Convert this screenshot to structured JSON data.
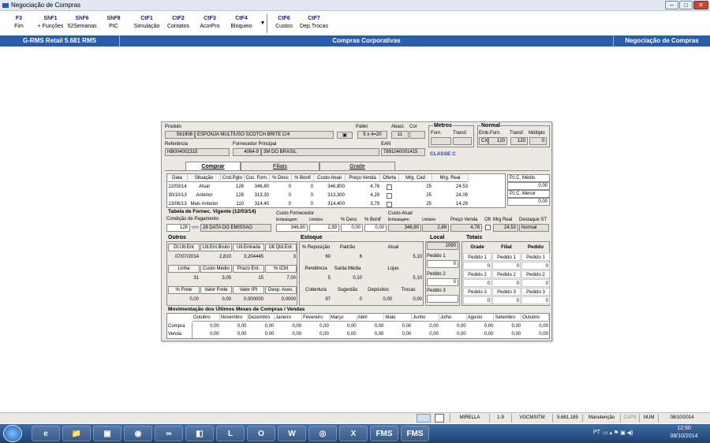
{
  "window": {
    "title": "Negociação de Compras",
    "controls": [
      "–",
      "□",
      "✕"
    ]
  },
  "fkeys": [
    {
      "key": "F3",
      "label": "Fim"
    },
    {
      "key": "ShF1",
      "label": "+ Funções"
    },
    {
      "key": "ShF6",
      "label": "52Semanas"
    },
    {
      "key": "ShF9",
      "label": "PIC"
    },
    {
      "key": "CtF1",
      "label": "Simulação"
    },
    {
      "key": "CtF2",
      "label": "Contatos"
    },
    {
      "key": "CtF3",
      "label": "AcorPro"
    },
    {
      "key": "CtF4",
      "label": "Bloqueio"
    },
    {
      "key": "CtF6",
      "label": "Custos"
    },
    {
      "key": "CtF7",
      "label": "Dep.Trocas"
    }
  ],
  "bluebar": {
    "left": "G-RMS Retail 5.681 RMS",
    "center": "Compras Corporativas",
    "right": "Negociação de Compras"
  },
  "product": {
    "produto_label": "Produto",
    "produto_code": "561908",
    "produto_desc": "ESPONJA MULTIUSO SCOTCH BRITE C/4",
    "pallet_label": "Pallet",
    "pallet_value": "5 x 4=20",
    "abast_label": "Abast.",
    "abast_value": "11",
    "cor_label": "Cor",
    "metros_label": "Metros",
    "forn_label": "Forn.",
    "transf_label": "Transf.",
    "normal_label": "Normal",
    "emb_forn_label": "Emb.Forn.",
    "transf2_label": "Transf.",
    "multiplo_label": "Múltiplo",
    "emb_unit": "CX",
    "emb_qty": "120",
    "transf_qty": "120",
    "multiplo_qty": "0",
    "referencia_label": "Referência",
    "referencia_value": "HB004002315",
    "fornecedor_label": "Fornecedor Principal",
    "fornecedor_code": "4064-9",
    "fornecedor_name": "3M DO BRASIL",
    "ean_label": "EAN",
    "ean_value": "7891040001415",
    "classe": "CLASSE C"
  },
  "tabs": [
    {
      "label": "Comprar"
    },
    {
      "label": "Filiais"
    },
    {
      "label": "Grade"
    }
  ],
  "history": {
    "headers": [
      "Data",
      "Situação",
      "Cnd.Pgto",
      "Cus. Forn.",
      "% Desc",
      "% Bonif",
      "Custo Atual",
      "Preço Venda",
      "Oferta",
      "Mrg. Cad",
      "Mrg. Real"
    ],
    "rows": [
      [
        "12/03/14",
        "Atual",
        "128",
        "346,80",
        "0",
        "0",
        "346,800",
        "4,78",
        "",
        "25",
        "24,53"
      ],
      [
        "30/10/13",
        "Anterior",
        "128",
        "313,30",
        "0",
        "0",
        "313,300",
        "4,29",
        "",
        "25",
        "24,09"
      ],
      [
        "13/06/13",
        "Mais Anterior",
        "110",
        "314,40",
        "0",
        "0",
        "314,400",
        "3,79",
        "",
        "25",
        "14,29"
      ]
    ],
    "pic_medio_label": "P.I.C. Médio",
    "pic_medio": "0.00",
    "pic_menor_label": "P.I.C. Menor",
    "pic_menor": "0.00"
  },
  "tabela": {
    "title": "Tabela de Fornec. Vigente (12/03/14)",
    "cond_label": "Condição de Pagamento",
    "cond_code": "128",
    "cond_desc": "28 DATA DO EMISSAO",
    "custo_forn_label": "Custo Fornecedor",
    "embalagem_label": "Embalagem",
    "unitario_label": "Unitário",
    "emb_value": "346,80",
    "unit_value": "2,89",
    "desc_label": "% Desc",
    "desc_value": "0,00",
    "bonif_label": "% Bonif",
    "bonif_value": "0,00",
    "custo_atual_label": "Custo Atual",
    "ca_emb_label": "Embalagem",
    "ca_unit_label": "Unitário",
    "ca_emb": "346,80",
    "ca_unit": "2,89",
    "preco_label": "Preço Venda",
    "preco_value": "4,78",
    "oft_label": "Oft",
    "mrg_label": "Mrg Real",
    "mrg_value": "24,53",
    "destaque_label": "Destaque ST",
    "destaque_value": "Normal"
  },
  "outros": {
    "title": "Outros",
    "row1_labels": [
      "Dt.Últ.Ent",
      "Últ.Ent.Bruto",
      "Últ.Entrada",
      "Últ.Qtd.Ent."
    ],
    "row1_values": [
      "07/07/2014",
      "2,810",
      "3,204445",
      "3"
    ],
    "row2_labels": [
      "Linha",
      "Custo Médio",
      "Prazo Ent.",
      "% ICM"
    ],
    "row2_values": [
      "31",
      "3,05",
      "15",
      "7,00"
    ],
    "row3_labels": [
      "% Frete",
      "Valor Frete",
      "Valor IPI",
      "Desp. Aces."
    ],
    "row3_values": [
      "0,00",
      "0,00",
      "0,000000",
      "0,0000"
    ]
  },
  "estoque": {
    "title": "Estoque",
    "row1_labels": [
      "% Reposição",
      "Padrão",
      "Atual"
    ],
    "row1_values": [
      "60",
      "6",
      "5,10"
    ],
    "row2_labels": [
      "Pendência",
      "Saída Média",
      "Lojas"
    ],
    "row2_values": [
      "5",
      "0,10",
      "5,10"
    ],
    "row3_labels": [
      "Cobertura",
      "Sugestão",
      "Depósitos",
      "Trocas"
    ],
    "row3_values": [
      "97",
      "0",
      "0,00",
      "0,00"
    ]
  },
  "local": {
    "title": "Local",
    "value": "1090",
    "pedido1_label": "Pedido 1",
    "pedido1": "0",
    "pedido2_label": "Pedido 2",
    "pedido2": "0",
    "pedido3_label": "Pedido 3",
    "pedido3": ""
  },
  "totais": {
    "title": "Totais",
    "headers": [
      "Grade",
      "Filial",
      "Pedido"
    ],
    "rows": [
      [
        "Pedido 1",
        "Pedido 1",
        "Pedido 1"
      ],
      [
        "0",
        "0",
        "0"
      ],
      [
        "Pedido 2",
        "Pedido 2",
        "Pedido 2"
      ],
      [
        "0",
        "0",
        "0"
      ],
      [
        "Pedido 3",
        "Pedido 3",
        "Pedido 3"
      ],
      [
        "0",
        "0",
        "0"
      ]
    ]
  },
  "movimentacao": {
    "title": "Movimentação dos Últimos Meses de Compras / Vendas",
    "months": [
      "Outubro",
      "Novembro",
      "Dezembro",
      "Janeiro",
      "Fevereiro",
      "Março",
      "Abril",
      "Maio",
      "Junho",
      "Julho",
      "Agosto",
      "Setembro",
      "Outubro"
    ],
    "rows": [
      {
        "label": "Compra",
        "values": [
          "0,00",
          "0,00",
          "0,00",
          "0,00",
          "0,00",
          "0,00",
          "0,00",
          "0,00",
          "0,00",
          "0,00",
          "0,00",
          "0,00",
          "0,00"
        ]
      },
      {
        "label": "Venda",
        "values": [
          "0,00",
          "0,00",
          "0,00",
          "0,00",
          "0,00",
          "0,00",
          "0,00",
          "0,00",
          "0,00",
          "0,00",
          "0,00",
          "0,00",
          "0,00"
        ]
      }
    ]
  },
  "status": {
    "user": "MIRELLA",
    "page": "1-9",
    "server": "VGCMSITM",
    "version": "5.681.185",
    "mode": "Manutenção",
    "caps": "CAPS",
    "num": "NUM",
    "date": "08/10/2014"
  },
  "taskbar": {
    "apps": [
      "e",
      "📁",
      "▣",
      "◉",
      "∞",
      "◧",
      "L",
      "O",
      "W",
      "◎",
      "X",
      "FMS",
      "FMS"
    ],
    "lang": "PT",
    "time": "12:50",
    "date": "08/10/2014"
  },
  "colors": {
    "titlebar": "#dfe8f3",
    "bluebar": "#2a5cb0",
    "panel": "#ece9e2",
    "classe": "#2a3fb0",
    "taskbar": "#2a5590"
  }
}
